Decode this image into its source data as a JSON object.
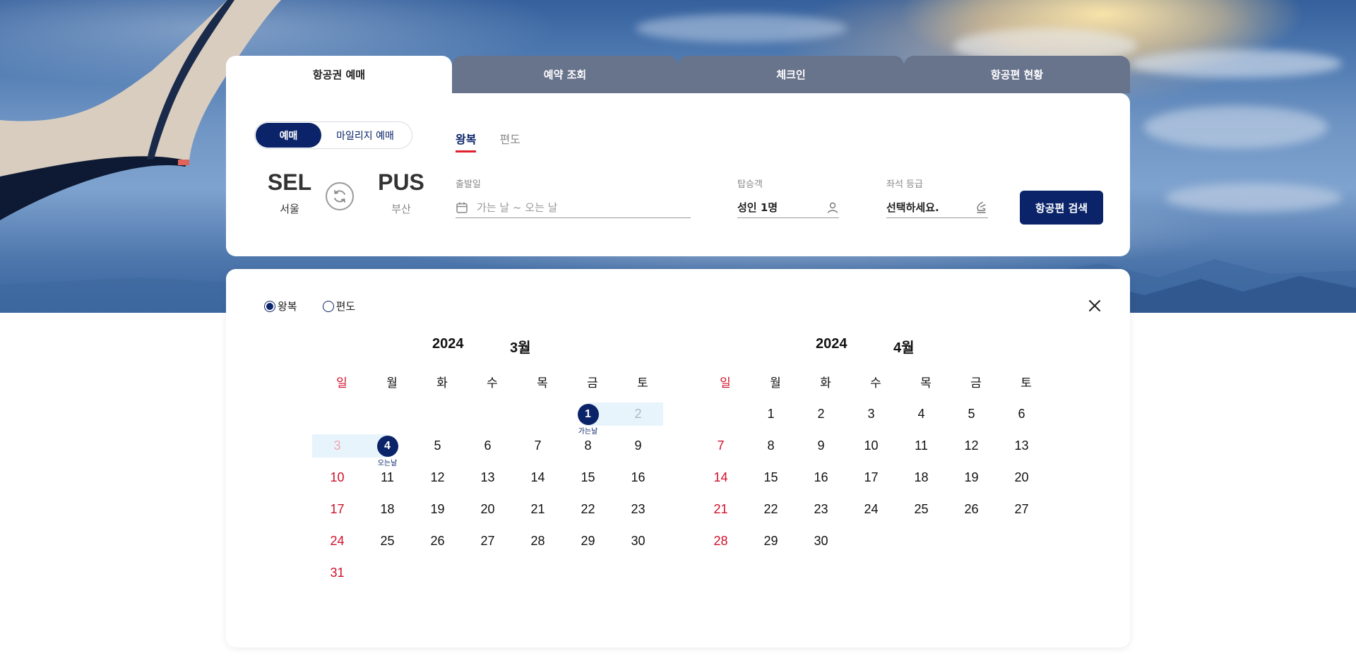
{
  "tabs": [
    "항공권 예매",
    "예약 조회",
    "체크인",
    "항공편 현황"
  ],
  "booking_type": {
    "selected": "예매",
    "other": "마일리지 예매"
  },
  "trip_type": {
    "selected": "왕복",
    "other": "편도"
  },
  "route": {
    "from": {
      "code": "SEL",
      "name": "서울"
    },
    "to": {
      "code": "PUS",
      "name": "부산"
    }
  },
  "date_field": {
    "label": "출발일",
    "placeholder": "가는 날 ~ 오는 날"
  },
  "passenger_field": {
    "label": "탑승객",
    "value": "성인 1명"
  },
  "seat_field": {
    "label": "좌석 등급",
    "value": "선택하세요."
  },
  "search_button": "항공편 검색",
  "calendar": {
    "radio_options": [
      "왕복",
      "편도"
    ],
    "radio_selected": 0,
    "weekdays": [
      "일",
      "월",
      "화",
      "수",
      "목",
      "금",
      "토"
    ],
    "depart_label": "가는날",
    "return_label": "오는날",
    "months": [
      {
        "year": "2024",
        "month": "3월",
        "first_weekday": 5,
        "days": 31,
        "depart": 1,
        "return": 4
      },
      {
        "year": "2024",
        "month": "4월",
        "first_weekday": 1,
        "days": 30
      }
    ]
  },
  "colors": {
    "navy": "#0a2369",
    "sunday_red": "#d0102a",
    "range_bg": "#e8f4fb",
    "accent_underline": "#e0202c"
  },
  "icons": [
    "swap-icon",
    "calendar-icon",
    "person-icon",
    "seat-icon",
    "close-icon"
  ]
}
